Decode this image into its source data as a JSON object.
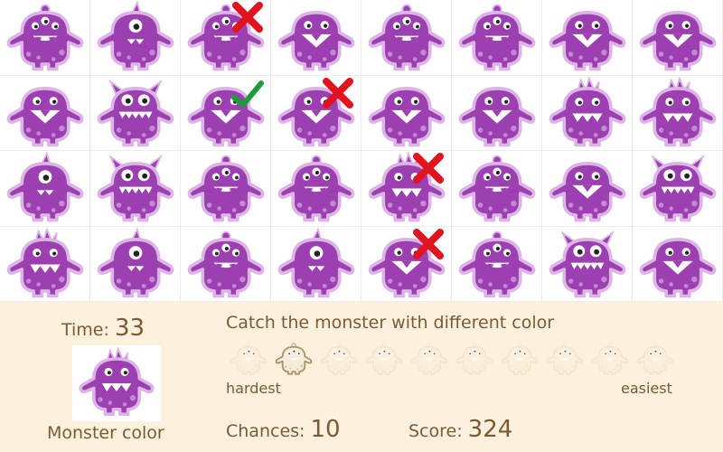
{
  "colors": {
    "monster": "#9c3fb1",
    "monster_odd": "#a64cc4",
    "outline": "#ddb4e6",
    "spot": "#c18ad2",
    "cross": "#e0131f",
    "check": "#1f9a3a",
    "panel_bg": "#fdf1dd",
    "text": "#7a5a34"
  },
  "board": {
    "rows": [
      [
        {
          "kind": "alien",
          "mark": null
        },
        {
          "kind": "cyclops",
          "mark": null
        },
        {
          "kind": "alien",
          "mark": "cross"
        },
        {
          "kind": "grin",
          "mark": null
        },
        {
          "kind": "alien",
          "mark": null
        },
        {
          "kind": "alien",
          "mark": null
        },
        {
          "kind": "grin",
          "mark": null
        },
        {
          "kind": "grin",
          "mark": null
        }
      ],
      [
        {
          "kind": "grin",
          "mark": null
        },
        {
          "kind": "horned",
          "mark": null
        },
        {
          "kind": "grin",
          "mark": "check"
        },
        {
          "kind": "grin",
          "mark": "cross"
        },
        {
          "kind": "grin",
          "mark": null
        },
        {
          "kind": "grin",
          "mark": null
        },
        {
          "kind": "spiky",
          "mark": null
        },
        {
          "kind": "spiky",
          "mark": null
        }
      ],
      [
        {
          "kind": "cyclops",
          "mark": null
        },
        {
          "kind": "horned",
          "mark": null
        },
        {
          "kind": "alien",
          "mark": null
        },
        {
          "kind": "alien",
          "mark": null
        },
        {
          "kind": "spiky",
          "mark": "cross"
        },
        {
          "kind": "alien",
          "mark": null
        },
        {
          "kind": "grin",
          "mark": null
        },
        {
          "kind": "horned",
          "mark": null
        }
      ],
      [
        {
          "kind": "spiky",
          "mark": null
        },
        {
          "kind": "cyclops",
          "mark": null
        },
        {
          "kind": "alien",
          "mark": null
        },
        {
          "kind": "cyclops",
          "mark": null
        },
        {
          "kind": "grin",
          "mark": "cross"
        },
        {
          "kind": "alien",
          "mark": null
        },
        {
          "kind": "horned",
          "mark": null
        },
        {
          "kind": "grin",
          "mark": null
        }
      ]
    ]
  },
  "panel": {
    "time_label": "Time:",
    "time_value": "33",
    "instruction": "Catch the monster with different color",
    "difficulty_left": "hardest",
    "difficulty_right": "easiest",
    "difficulty_count": 10,
    "difficulty_selected": 1,
    "monster_color_label": "Monster color",
    "swatch_kind": "spiky",
    "chances_label": "Chances:",
    "chances_value": "10",
    "score_label": "Score:",
    "score_value": "324"
  }
}
